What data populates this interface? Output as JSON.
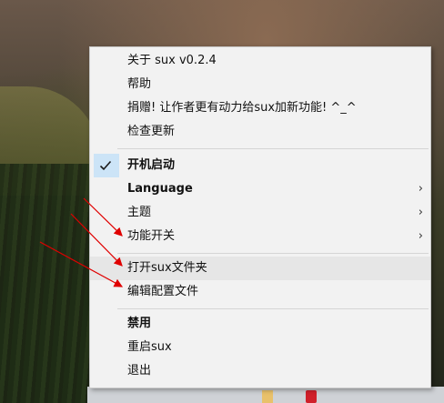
{
  "menu": {
    "items": [
      {
        "label": "关于 sux v0.2.4"
      },
      {
        "label": "帮助"
      },
      {
        "label": "捐赠! 让作者更有动力给sux加新功能! ^_^"
      },
      {
        "label": "检查更新"
      },
      {
        "label": "开机启动",
        "checked": true
      },
      {
        "label": "Language",
        "submenu": true
      },
      {
        "label": "主题",
        "submenu": true
      },
      {
        "label": "功能开关",
        "submenu": true
      },
      {
        "label": "打开sux文件夹"
      },
      {
        "label": "编辑配置文件"
      },
      {
        "label": "禁用"
      },
      {
        "label": "重启sux"
      },
      {
        "label": "退出"
      }
    ]
  },
  "icons": {
    "check": "check-icon",
    "submenu": "chevron-right-icon"
  },
  "colors": {
    "menu_bg": "#f2f2f2",
    "check_bg": "#cce4f7",
    "check_mark": "#1a1a1a",
    "annotation_arrow": "#e00000"
  }
}
